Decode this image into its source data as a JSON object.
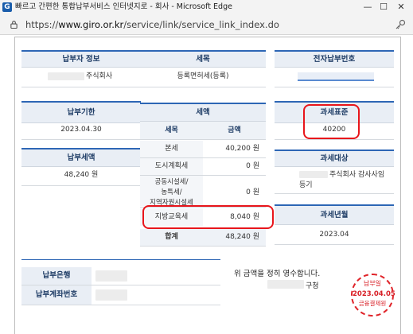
{
  "window": {
    "title": "빠르고 간편한 통합납부서비스 인터넷지로 - 회사 - Microsoft Edge",
    "controls": {
      "minimize": "—",
      "maximize": "☐",
      "close": "✕"
    }
  },
  "address": {
    "scheme": "https://",
    "domain": "www.giro.or.kr",
    "path": "/service/link/service_link_index.do"
  },
  "panels": {
    "payer_info": {
      "label": "납부자 정보",
      "value": "주식회사"
    },
    "tax_item": {
      "label": "세목",
      "value": "등록면허세(등록)"
    },
    "epay_number": {
      "label": "전자납부번호"
    },
    "due_date": {
      "label": "납부기한",
      "value": "2023.04.30"
    },
    "tax_base": {
      "label": "과세표준",
      "value": "40200"
    },
    "paid_amount": {
      "label": "납부세액",
      "value": "48,240 원"
    },
    "tax_object": {
      "label": "과세대상",
      "value_line1": "주식회사 감사사임",
      "value_line2": "등기"
    },
    "tax_year_month": {
      "label": "과세년월",
      "value": "2023.04"
    }
  },
  "tax_amount": {
    "title": "세액",
    "columns": [
      "세목",
      "금액"
    ],
    "rows": [
      {
        "name": "본세",
        "amount": "40,200 원"
      },
      {
        "name": "도시계획세",
        "amount": "0 원"
      },
      {
        "name_line1": "공동시설세/",
        "name_line2": "농특세/",
        "name_line3": "지역자원시설세",
        "amount": "0 원"
      },
      {
        "name": "지방교육세",
        "amount": "8,040 원"
      }
    ],
    "total": {
      "name": "합계",
      "amount": "48,240 원"
    }
  },
  "bank": {
    "bank_label": "납부은행",
    "account_label": "납부계좌번호"
  },
  "receipt": {
    "text": "위 금액을 정히 영수합니다.",
    "office_suffix": "구청"
  },
  "stamp": {
    "line1": "납부일",
    "line2": "2023.04.05",
    "line3": "금융결제원"
  },
  "colors": {
    "accent": "#2d66b5",
    "highlight": "#e8151b",
    "stamp": "#d82027"
  }
}
